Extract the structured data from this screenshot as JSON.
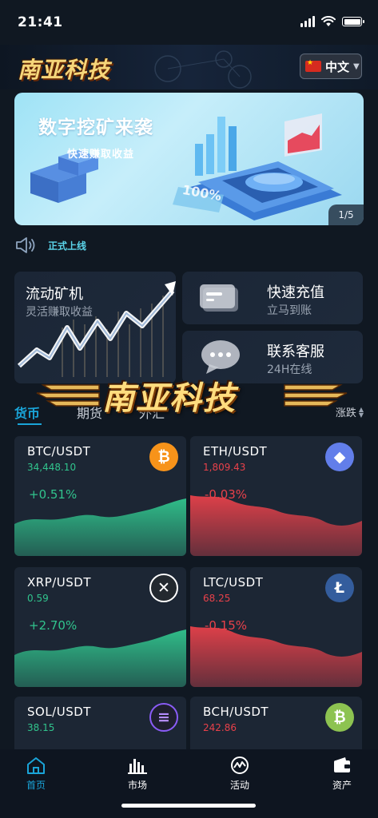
{
  "status": {
    "time": "21:41"
  },
  "header": {
    "logo_text": "南亚科技",
    "language": "中文"
  },
  "banner": {
    "title": "数字挖矿来袭",
    "subtitle": "快速赚取收益",
    "badge": "100%",
    "page_indicator": "1/5"
  },
  "notice": {
    "text": "正式上线"
  },
  "features": {
    "liquidity": {
      "title": "流动矿机",
      "subtitle": "灵活赚取收益"
    },
    "deposit": {
      "title": "快速充值",
      "subtitle": "立马到账"
    },
    "service": {
      "title": "联系客服",
      "subtitle": "24H在线"
    }
  },
  "watermark": {
    "text": "南亚科技"
  },
  "tabs": {
    "items": [
      "货币",
      "期货",
      "外汇"
    ],
    "active": "货币",
    "sort_label": "涨跌"
  },
  "coins": [
    {
      "pair": "BTC/USDT",
      "price": "34,448.10",
      "change": "+0.51%",
      "trend": "up",
      "icon": "bitcoin-icon",
      "icon_color": "#f7931a",
      "symbol": "₿"
    },
    {
      "pair": "ETH/USDT",
      "price": "1,809.43",
      "change": "-0.03%",
      "trend": "down",
      "icon": "ethereum-icon",
      "icon_color": "#627eea",
      "symbol": "◆"
    },
    {
      "pair": "XRP/USDT",
      "price": "0.59",
      "change": "+2.70%",
      "trend": "up",
      "icon": "xrp-icon",
      "icon_color": "#23292f",
      "symbol": "✕"
    },
    {
      "pair": "LTC/USDT",
      "price": "68.25",
      "change": "-0.15%",
      "trend": "down",
      "icon": "litecoin-icon",
      "icon_color": "#345d9d",
      "symbol": "Ł"
    },
    {
      "pair": "SOL/USDT",
      "price": "38.15",
      "change": "",
      "trend": "up",
      "icon": "solana-icon",
      "icon_color": "#1f1f2e",
      "symbol": "≡"
    },
    {
      "pair": "BCH/USDT",
      "price": "242.86",
      "change": "",
      "trend": "down",
      "icon": "bitcoin-cash-icon",
      "icon_color": "#8dc351",
      "symbol": "₿"
    }
  ],
  "nav": {
    "items": [
      "首页",
      "市场",
      "活动",
      "资产"
    ],
    "active": "首页"
  },
  "colors": {
    "accent": "#1aa4d8",
    "up": "#31c48d",
    "down": "#e8414a",
    "background": "#101822",
    "card": "#1c2634"
  }
}
